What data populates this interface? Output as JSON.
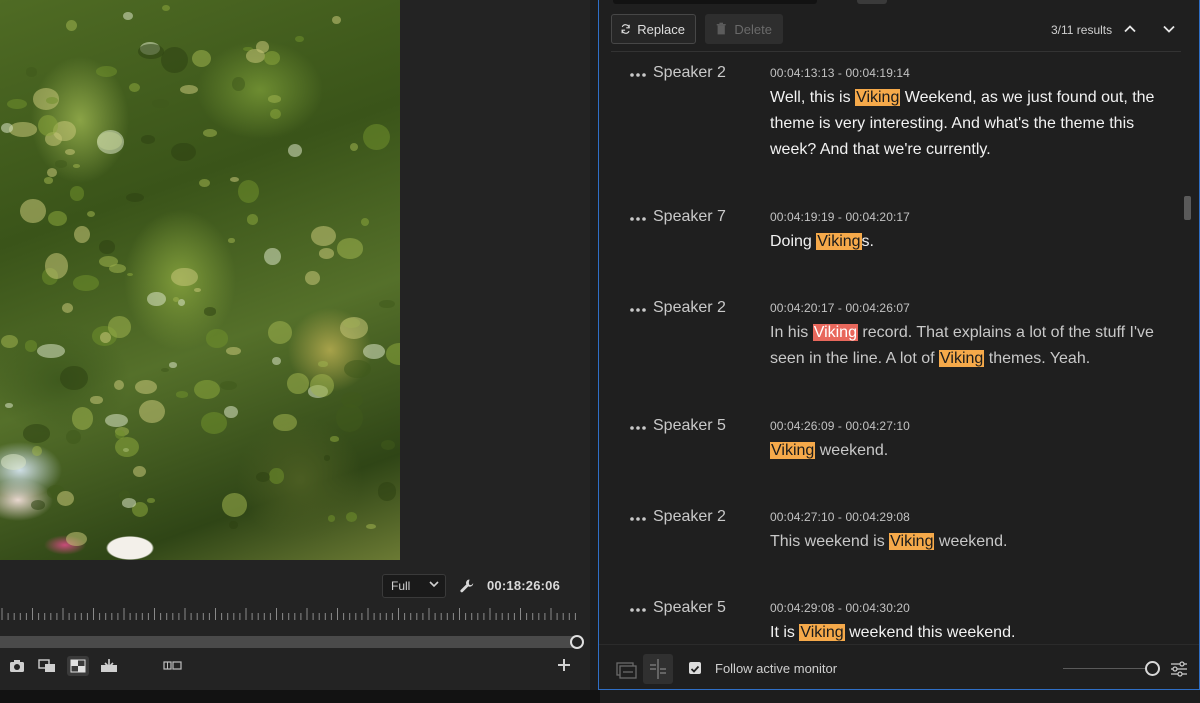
{
  "monitor": {
    "zoom_value": "Full",
    "timecode": "00:18:26:06",
    "icons": [
      "camera-icon",
      "overlay-icon",
      "compare-icon",
      "export-frame-icon",
      "multicam-icon",
      "add-icon",
      "wrench-icon"
    ]
  },
  "toolbar": {
    "replace_label": "Replace",
    "delete_label": "Delete",
    "results": "3/11 results"
  },
  "transcript": [
    {
      "speaker": "Speaker 2",
      "timecode": "00:04:13:13 - 00:04:19:14",
      "text_parts": [
        "Well, this is ",
        "Viking",
        " Weekend, as we just found out, the theme is very interesting. And what's the theme this week? And that we're currently."
      ]
    },
    {
      "speaker": "Speaker 7",
      "timecode": "00:04:19:19 - 00:04:20:17",
      "text_parts": [
        "Doing ",
        "Viking",
        "s."
      ]
    },
    {
      "speaker": "Speaker 2",
      "timecode": "00:04:20:17 - 00:04:26:07",
      "text_parts": [
        "In his ",
        "Viking",
        " record. That explains a lot of the stuff I've seen in the line. A lot of ",
        "Viking",
        " themes. Yeah."
      ]
    },
    {
      "speaker": "Speaker 5",
      "timecode": "00:04:26:09 - 00:04:27:10",
      "text_parts": [
        "",
        "Viking",
        " weekend."
      ]
    },
    {
      "speaker": "Speaker 2",
      "timecode": "00:04:27:10 - 00:04:29:08",
      "text_parts": [
        "This weekend is ",
        "Viking",
        " weekend."
      ]
    },
    {
      "speaker": "Speaker 5",
      "timecode": "00:04:29:08 - 00:04:30:20",
      "text_parts": [
        "It is ",
        "Viking",
        " weekend this weekend."
      ]
    }
  ],
  "footer": {
    "follow_label": "Follow active monitor",
    "follow_checked": true
  },
  "colors": {
    "highlight": "#f5a94a",
    "current_highlight": "#e8685c",
    "panel_border": "#2f6fc6"
  }
}
